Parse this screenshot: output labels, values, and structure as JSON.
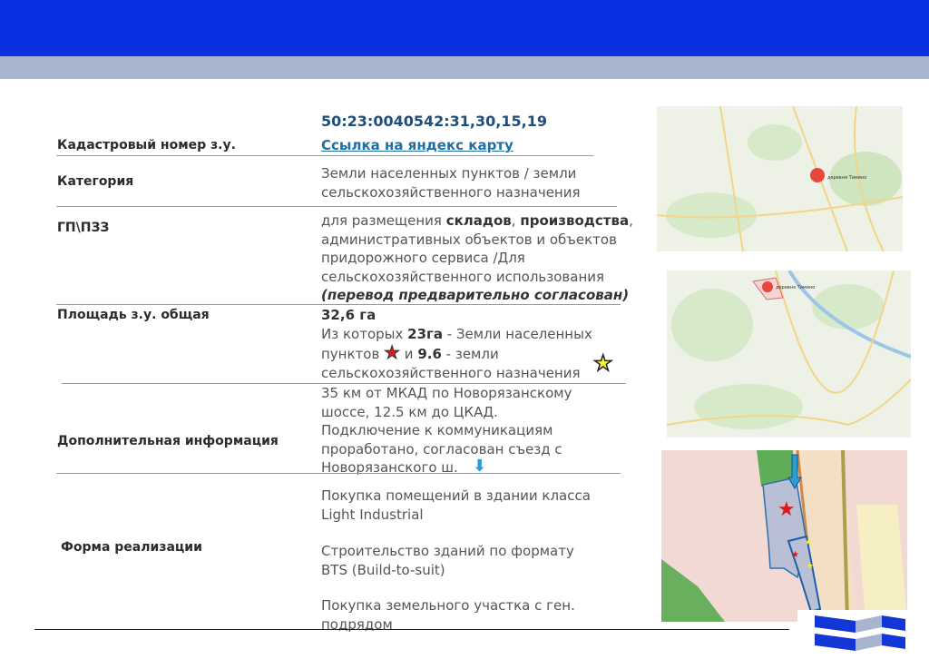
{
  "header": {
    "bar_color": "#0b2fe2",
    "band_color": "#a9b5cf"
  },
  "rows": [
    {
      "label": "Кадастровый номер з.у.",
      "cadastral_number": "50:23:0040542:31,30,15,19",
      "link": "Ссылка на яндекс карту"
    },
    {
      "label": "Категория",
      "value": "Земли населенных пунктов / земли сельскохозяйственного назначения"
    },
    {
      "label": "ГП\\ПЗЗ",
      "v1": "для размещения ",
      "v2": "складов",
      "v3": ", ",
      "v4": "производства",
      "v5": ", административных объектов и объектов придорожного сервиса /Для сельскохозяйственного использования ",
      "v6": "(перевод предварительно согласован)"
    },
    {
      "label": "Площадь з.у. общая",
      "total": "32,6 га",
      "p1": "Из которых ",
      "p2": "23га",
      "p3": " - Земли населенных пунктов ",
      "p4": " и ",
      "p5": "9.6",
      "p6": " - земли сельскохозяйственного назначения"
    },
    {
      "label": "Дополнительная информация",
      "value": "35 км от МКАД по Новорязанскому шоссе, 12.5 км до ЦКАД. Подключение к коммуникациям проработано, согласован съезд с Новорязанского ш."
    },
    {
      "label": "Форма реализации",
      "options": [
        "Покупка помещений в здании класса Light Industrial",
        "Строительство зданий по формату BTS (Build-to-suit)",
        "Покупка земельного участка с ген. подрядом"
      ]
    }
  ],
  "maps": {
    "pin_label": "деревня Тимино"
  },
  "colors": {
    "red_star": "#e0161e",
    "yellow_star": "#f5f03a",
    "arrow": "#2a9fd6"
  }
}
